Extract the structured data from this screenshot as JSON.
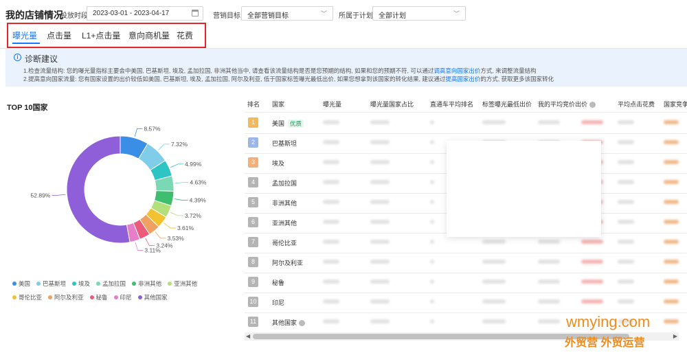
{
  "header": {
    "title": "我的店铺情况",
    "period_label": "投放时段:",
    "date_range": "2023-03-01 - 2023-04-17",
    "goal_label": "营销目标:",
    "goal_value": "全部营销目标",
    "plan_label": "所属于计划:",
    "plan_value": "全部计划"
  },
  "tabs": [
    "曝光量",
    "点击量",
    "L1+点击量",
    "意向商机量",
    "花费"
  ],
  "active_tab": "曝光量",
  "diagnosis": {
    "title": "诊断建议",
    "line1_a": "1.检查流量结构: 您的曝光量指标主要会中美国, 巴基斯坦, 埃及, 孟加拉国, 非洲其他当中, 请查看该流量结构是否是您预期的结构, 如果和您的预期不符, 可以通过",
    "line1_link": "调高意向国家出价",
    "line1_b": "方式, 来调整流量结构",
    "line2_a": "2.提高意向国家流量: 您有国家设置的出价较低如美国, 巴基斯坦, 埃及, 孟加拉国, 阿尔及利亚, 低于国家标签曝光最低出价, 如果您想拿到该国家的转化结果, 建议通过",
    "line2_link": "提高国家出价",
    "line2_b": "的方式, 获取更多该国家转化"
  },
  "chart_title": "TOP 10国家",
  "chart_data": {
    "type": "pie",
    "categories": [
      "美国",
      "巴基斯坦",
      "埃及",
      "孟加拉国",
      "非洲其他",
      "亚洲其他",
      "哥伦比亚",
      "阿尔及利亚",
      "秘鲁",
      "印尼",
      "其他国家"
    ],
    "values": [
      8.57,
      7.32,
      4.99,
      4.63,
      4.39,
      3.72,
      3.61,
      3.53,
      3.24,
      3.11,
      52.89
    ],
    "labels": [
      "8.57%",
      "7.32%",
      "4.99%",
      "4.63%",
      "4.39%",
      "3.72%",
      "3.61%",
      "3.53%",
      "3.24%",
      "3.11%",
      "52.89%"
    ],
    "colors": [
      "#3a8ee6",
      "#7fcde8",
      "#2ec4c4",
      "#7ad9b4",
      "#3dbf6e",
      "#b3e07a",
      "#f2c230",
      "#f0a060",
      "#ec5b7a",
      "#e67fc7",
      "#8f5ed9"
    ],
    "legend_position": "bottom"
  },
  "table": {
    "headers": [
      "排名",
      "国家",
      "曝光量",
      "曝光量国家占比",
      "直通车平均排名",
      "标签曝光最低出价",
      "我的平均竞价出价",
      "平均点击花费",
      "国家竞争"
    ],
    "rows": [
      {
        "rank": "1",
        "country": "美国",
        "badge": "优质"
      },
      {
        "rank": "2",
        "country": "巴基斯坦"
      },
      {
        "rank": "3",
        "country": "埃及"
      },
      {
        "rank": "4",
        "country": "孟加拉国"
      },
      {
        "rank": "5",
        "country": "非洲其他"
      },
      {
        "rank": "6",
        "country": "亚洲其他"
      },
      {
        "rank": "7",
        "country": "哥伦比亚"
      },
      {
        "rank": "8",
        "country": "阿尔及利亚"
      },
      {
        "rank": "9",
        "country": "秘鲁"
      },
      {
        "rank": "10",
        "country": "印尼"
      },
      {
        "rank": "11",
        "country": "其他国家"
      }
    ],
    "rank_colors": [
      "#f5b85b",
      "#9db6e8",
      "#f5b07a",
      "#b5b5b5"
    ]
  },
  "watermark": {
    "line1": "wmying.com",
    "line2": "外贸营 外贸运营"
  }
}
